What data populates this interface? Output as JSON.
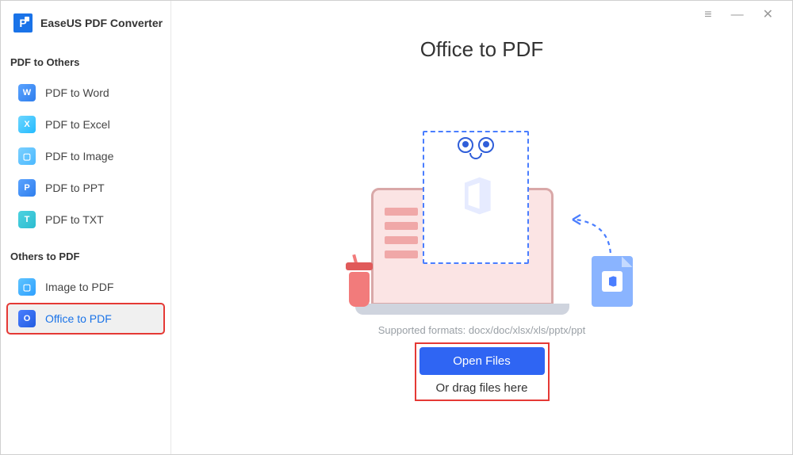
{
  "app": {
    "title": "EaseUS PDF Converter"
  },
  "sidebar": {
    "section1_label": "PDF to Others",
    "section2_label": "Others to PDF",
    "items1": [
      {
        "label": "PDF to Word",
        "glyph": "W"
      },
      {
        "label": "PDF to Excel",
        "glyph": "X"
      },
      {
        "label": "PDF to Image",
        "glyph": "▢"
      },
      {
        "label": "PDF to PPT",
        "glyph": "P"
      },
      {
        "label": "PDF to TXT",
        "glyph": "T"
      }
    ],
    "items2": [
      {
        "label": "Image to PDF",
        "glyph": "▢"
      },
      {
        "label": "Office to PDF",
        "glyph": "O"
      }
    ]
  },
  "main": {
    "title": "Office to PDF",
    "supported_label": "Supported formats: docx/doc/xlsx/xls/pptx/ppt",
    "open_button": "Open Files",
    "drag_text": "Or drag files here"
  }
}
